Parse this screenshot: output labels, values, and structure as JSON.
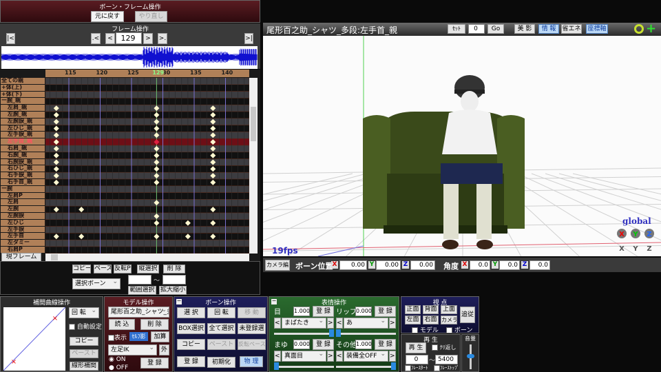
{
  "bone_frame_panel": {
    "title": "ボーン・フレーム操作",
    "undo": "元に戻す",
    "redo": "やり直し"
  },
  "frame_panel": {
    "title": "フレーム操作",
    "first": "|<",
    "prev_key": ".<",
    "prev": "<",
    "frame": "129",
    "next": ">",
    "next_key": ">.",
    "last": ">|"
  },
  "timeline": {
    "ruler": [
      "115",
      "120",
      "125",
      "130",
      "135",
      "140"
    ],
    "current_frame": 129,
    "current_label": "129",
    "rows": [
      {
        "label": "全ての親",
        "keys": []
      },
      {
        "label": "+体(上)",
        "keys": []
      },
      {
        "label": "+体(下)",
        "keys": []
      },
      {
        "label": "ー腕_親",
        "keys": []
      },
      {
        "label": "左肩_親",
        "keys": [
          113,
          129,
          138
        ]
      },
      {
        "label": "左腕_親",
        "keys": [
          113,
          129,
          138
        ]
      },
      {
        "label": "左腕捩_親",
        "keys": [
          113,
          129,
          138
        ]
      },
      {
        "label": "左ひじ_親",
        "keys": [
          113,
          129,
          138
        ]
      },
      {
        "label": "左手捩_親",
        "keys": [
          113,
          129,
          138
        ]
      },
      {
        "label": "左手首_親",
        "keys": [
          113,
          129,
          138
        ],
        "selected": true
      },
      {
        "label": "右肩_親",
        "keys": [
          113,
          129,
          138
        ]
      },
      {
        "label": "右腕_親",
        "keys": [
          113,
          129,
          138
        ]
      },
      {
        "label": "右腕捩_親",
        "keys": [
          113,
          129,
          138
        ]
      },
      {
        "label": "右ひじ_親",
        "keys": [
          113,
          129,
          138
        ]
      },
      {
        "label": "右手捩_親",
        "keys": [
          113,
          129,
          138
        ]
      },
      {
        "label": "右手首_親",
        "keys": [
          113,
          129,
          138
        ]
      },
      {
        "label": "ー腕",
        "keys": []
      },
      {
        "label": "左肩P",
        "keys": []
      },
      {
        "label": "左肩",
        "keys": [
          129
        ]
      },
      {
        "label": "左腕",
        "keys": [
          113,
          117,
          138
        ]
      },
      {
        "label": "左腕捩",
        "keys": [
          129
        ]
      },
      {
        "label": "左ひじ",
        "keys": [
          129,
          134,
          138
        ]
      },
      {
        "label": "左手捩",
        "keys": []
      },
      {
        "label": "左手首",
        "keys": [
          113,
          117,
          129,
          134,
          138
        ]
      },
      {
        "label": "左ダミー",
        "keys": []
      },
      {
        "label": "右肩P",
        "keys": []
      }
    ],
    "current_frame_button": "現フレーム"
  },
  "frame_tools": {
    "copy": "コピー",
    "paste": "ペースト",
    "flip_paste": "反転P",
    "vertical_select": "縦選択",
    "delete": "削 除",
    "select_mode": "選択ボーン",
    "range_from": "",
    "tilde": "～",
    "range_to": "",
    "range_select": "範囲選択",
    "scale": "拡大縮小"
  },
  "viewport": {
    "title": "尾形百之助_シャツ_多段:左手首_親",
    "set_label": "ｾｯﾄ",
    "set_value": "0",
    "go": "Go",
    "beauty": "美 影",
    "info": "情 報",
    "eco": "省エネ",
    "axes": "座標軸",
    "fps": "19fps",
    "global": "global",
    "axis_x": "X",
    "axis_y": "Y",
    "axis_z": "Z"
  },
  "coord_bar": {
    "camera_edit": "カメラ編",
    "bone_pos": "ボーン位置",
    "x": "X",
    "y": "Y",
    "z": "Z",
    "pos_x": "0.00",
    "pos_y": "0.00",
    "pos_z": "0.00",
    "angle": "角度",
    "rot_x": "0.0",
    "rot_y": "0.0",
    "rot_z": "0.0"
  },
  "interp_panel": {
    "title": "補間曲線操作",
    "mode": "回 転",
    "auto": "自動設定",
    "copy": "コピー",
    "paste": "ペースト",
    "linear": "線形補間"
  },
  "model_panel": {
    "title": "モデル操作",
    "model": "尾形百之助_シャツ_多",
    "load": "読 込",
    "delete": "削 除",
    "display": "表示",
    "self_shadow": "ｾﾙﾌ影",
    "add": "加算",
    "ik": "左足IK",
    "outside": "外",
    "on": "ON",
    "off": "OFF",
    "register": "登 録"
  },
  "bone_panel": {
    "title": "ボーン操作",
    "select": "選 択",
    "rotate": "回 転",
    "move": "移 動",
    "box_select": "BOX選択",
    "select_all": "全て選択",
    "unregistered": "未登録選",
    "copy": "コピー",
    "paste": "ペースト",
    "flip_paste": "反転ペースト",
    "register": "登 録",
    "reset": "初期化",
    "physics": "物 理"
  },
  "morph_panel": {
    "title": "表情操作",
    "eye": {
      "label": "目",
      "value": "1.000",
      "register": "登 録",
      "morph": "まばたき",
      "level": 1.0
    },
    "lip": {
      "label": "リップ",
      "value": "0.000",
      "register": "登 録",
      "morph": "あ",
      "level": 0.0
    },
    "brow": {
      "label": "まゆ",
      "value": "0.000",
      "register": "登 録",
      "morph": "真面目",
      "level": 0.0
    },
    "other": {
      "label": "その他",
      "value": "1.000",
      "register": "登 録",
      "morph": "装備全OFF",
      "level": 1.0
    },
    "prev": "<<",
    "next": ">>"
  },
  "view_panel": {
    "title": "視 点",
    "front": "正面",
    "back": "背面",
    "top": "上面",
    "left": "左面",
    "right": "右面",
    "camera": "カメラ",
    "follow": "追従",
    "model": "モデル",
    "bone": "ボーン"
  },
  "play_panel": {
    "title": "再 生",
    "play": "再 生",
    "repeat": "ｸﾘ返し",
    "from": "0",
    "tilde": "～",
    "to": "5400",
    "frame_start": "ﾌﾚｰｽﾀｰﾄ",
    "frame_stop": "ﾌﾚｰｽﾄｯﾌﾟ"
  },
  "volume_panel": {
    "title": "音量",
    "level": 0.55
  },
  "colors": {
    "panel_red": "#4a1418",
    "panel_navy": "#1c1c4a",
    "panel_green": "#1f4a22",
    "timeline_tan": "#b08058",
    "selected_row": "#6e0e16",
    "key": "#fff8d0"
  }
}
